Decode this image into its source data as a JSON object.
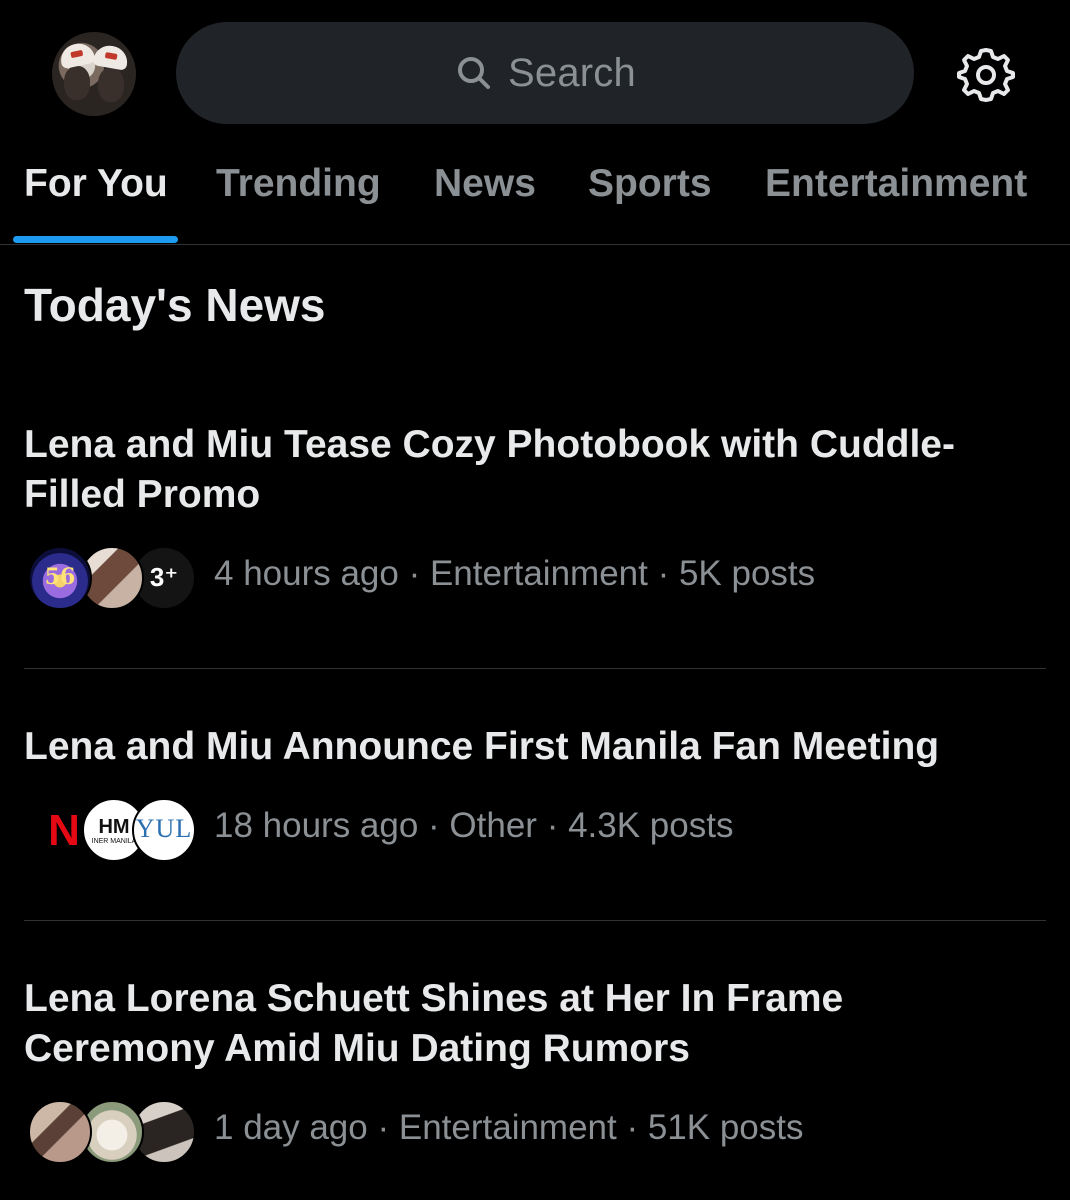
{
  "header": {
    "avatar_icon": "profile-avatar",
    "search": {
      "placeholder": "Search",
      "icon": "search-icon"
    },
    "settings_icon": "gear-icon"
  },
  "tabs": [
    {
      "label": "For You",
      "active": true
    },
    {
      "label": "Trending",
      "active": false
    },
    {
      "label": "News",
      "active": false
    },
    {
      "label": "Sports",
      "active": false
    },
    {
      "label": "Entertainment",
      "active": false
    }
  ],
  "section": {
    "title": "Today's News"
  },
  "news": [
    {
      "headline": "Lena and Miu Tease Cozy Photobook with Cuddle-Filled Promo",
      "meta": "4 hours ago · Entertainment · 5K posts",
      "avatars": [
        "logo-56-avatar",
        "duo-photo-avatar",
        "plus-logo-avatar"
      ],
      "avatar_labels": [
        "56",
        "3⁺"
      ]
    },
    {
      "headline": "Lena and Miu Announce First Manila Fan Meeting",
      "meta": "18 hours ago · Other · 4.3K posts",
      "avatars": [
        "netflix-logo-avatar",
        "hm-logo-avatar",
        "yul-logo-avatar"
      ],
      "avatar_labels": [
        "N",
        "HM",
        "INER MANILA",
        "YUL"
      ]
    },
    {
      "headline": "Lena Lorena Schuett Shines at Her In Frame Ceremony Amid Miu Dating Rumors",
      "meta": "1 day ago · Entertainment · 51K posts",
      "avatars": [
        "duo-photo-avatar",
        "dog-photo-avatar",
        "woman-photo-avatar"
      ]
    }
  ],
  "colors": {
    "background": "#000000",
    "search_bg": "#202327",
    "text_primary": "#e7e9ea",
    "text_secondary": "#8b9095",
    "accent": "#1d9bf0",
    "divider": "#2f3336"
  }
}
